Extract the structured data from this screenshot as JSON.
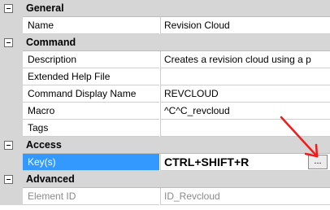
{
  "categories": {
    "general": "General",
    "command": "Command",
    "access": "Access",
    "advanced": "Advanced"
  },
  "props": {
    "name": {
      "label": "Name",
      "value": "Revision Cloud"
    },
    "description": {
      "label": "Description",
      "value": "Creates a revision cloud using a p"
    },
    "help_file": {
      "label": "Extended Help File",
      "value": ""
    },
    "display_name": {
      "label": "Command Display Name",
      "value": "REVCLOUD"
    },
    "macro": {
      "label": "Macro",
      "value": "^C^C_revcloud"
    },
    "tags": {
      "label": "Tags",
      "value": ""
    },
    "keys": {
      "label": "Key(s)",
      "value": "CTRL+SHIFT+R",
      "button": "..."
    },
    "element_id": {
      "label": "Element ID",
      "value": "ID_Revcloud"
    }
  },
  "colors": {
    "selection": "#3399ff",
    "annotation_arrow": "#ee1c1c",
    "category_bg": "#d6d6d6"
  },
  "icons": {
    "collapse": "minus-box-icon",
    "annotation": "red-arrow-annotation"
  }
}
